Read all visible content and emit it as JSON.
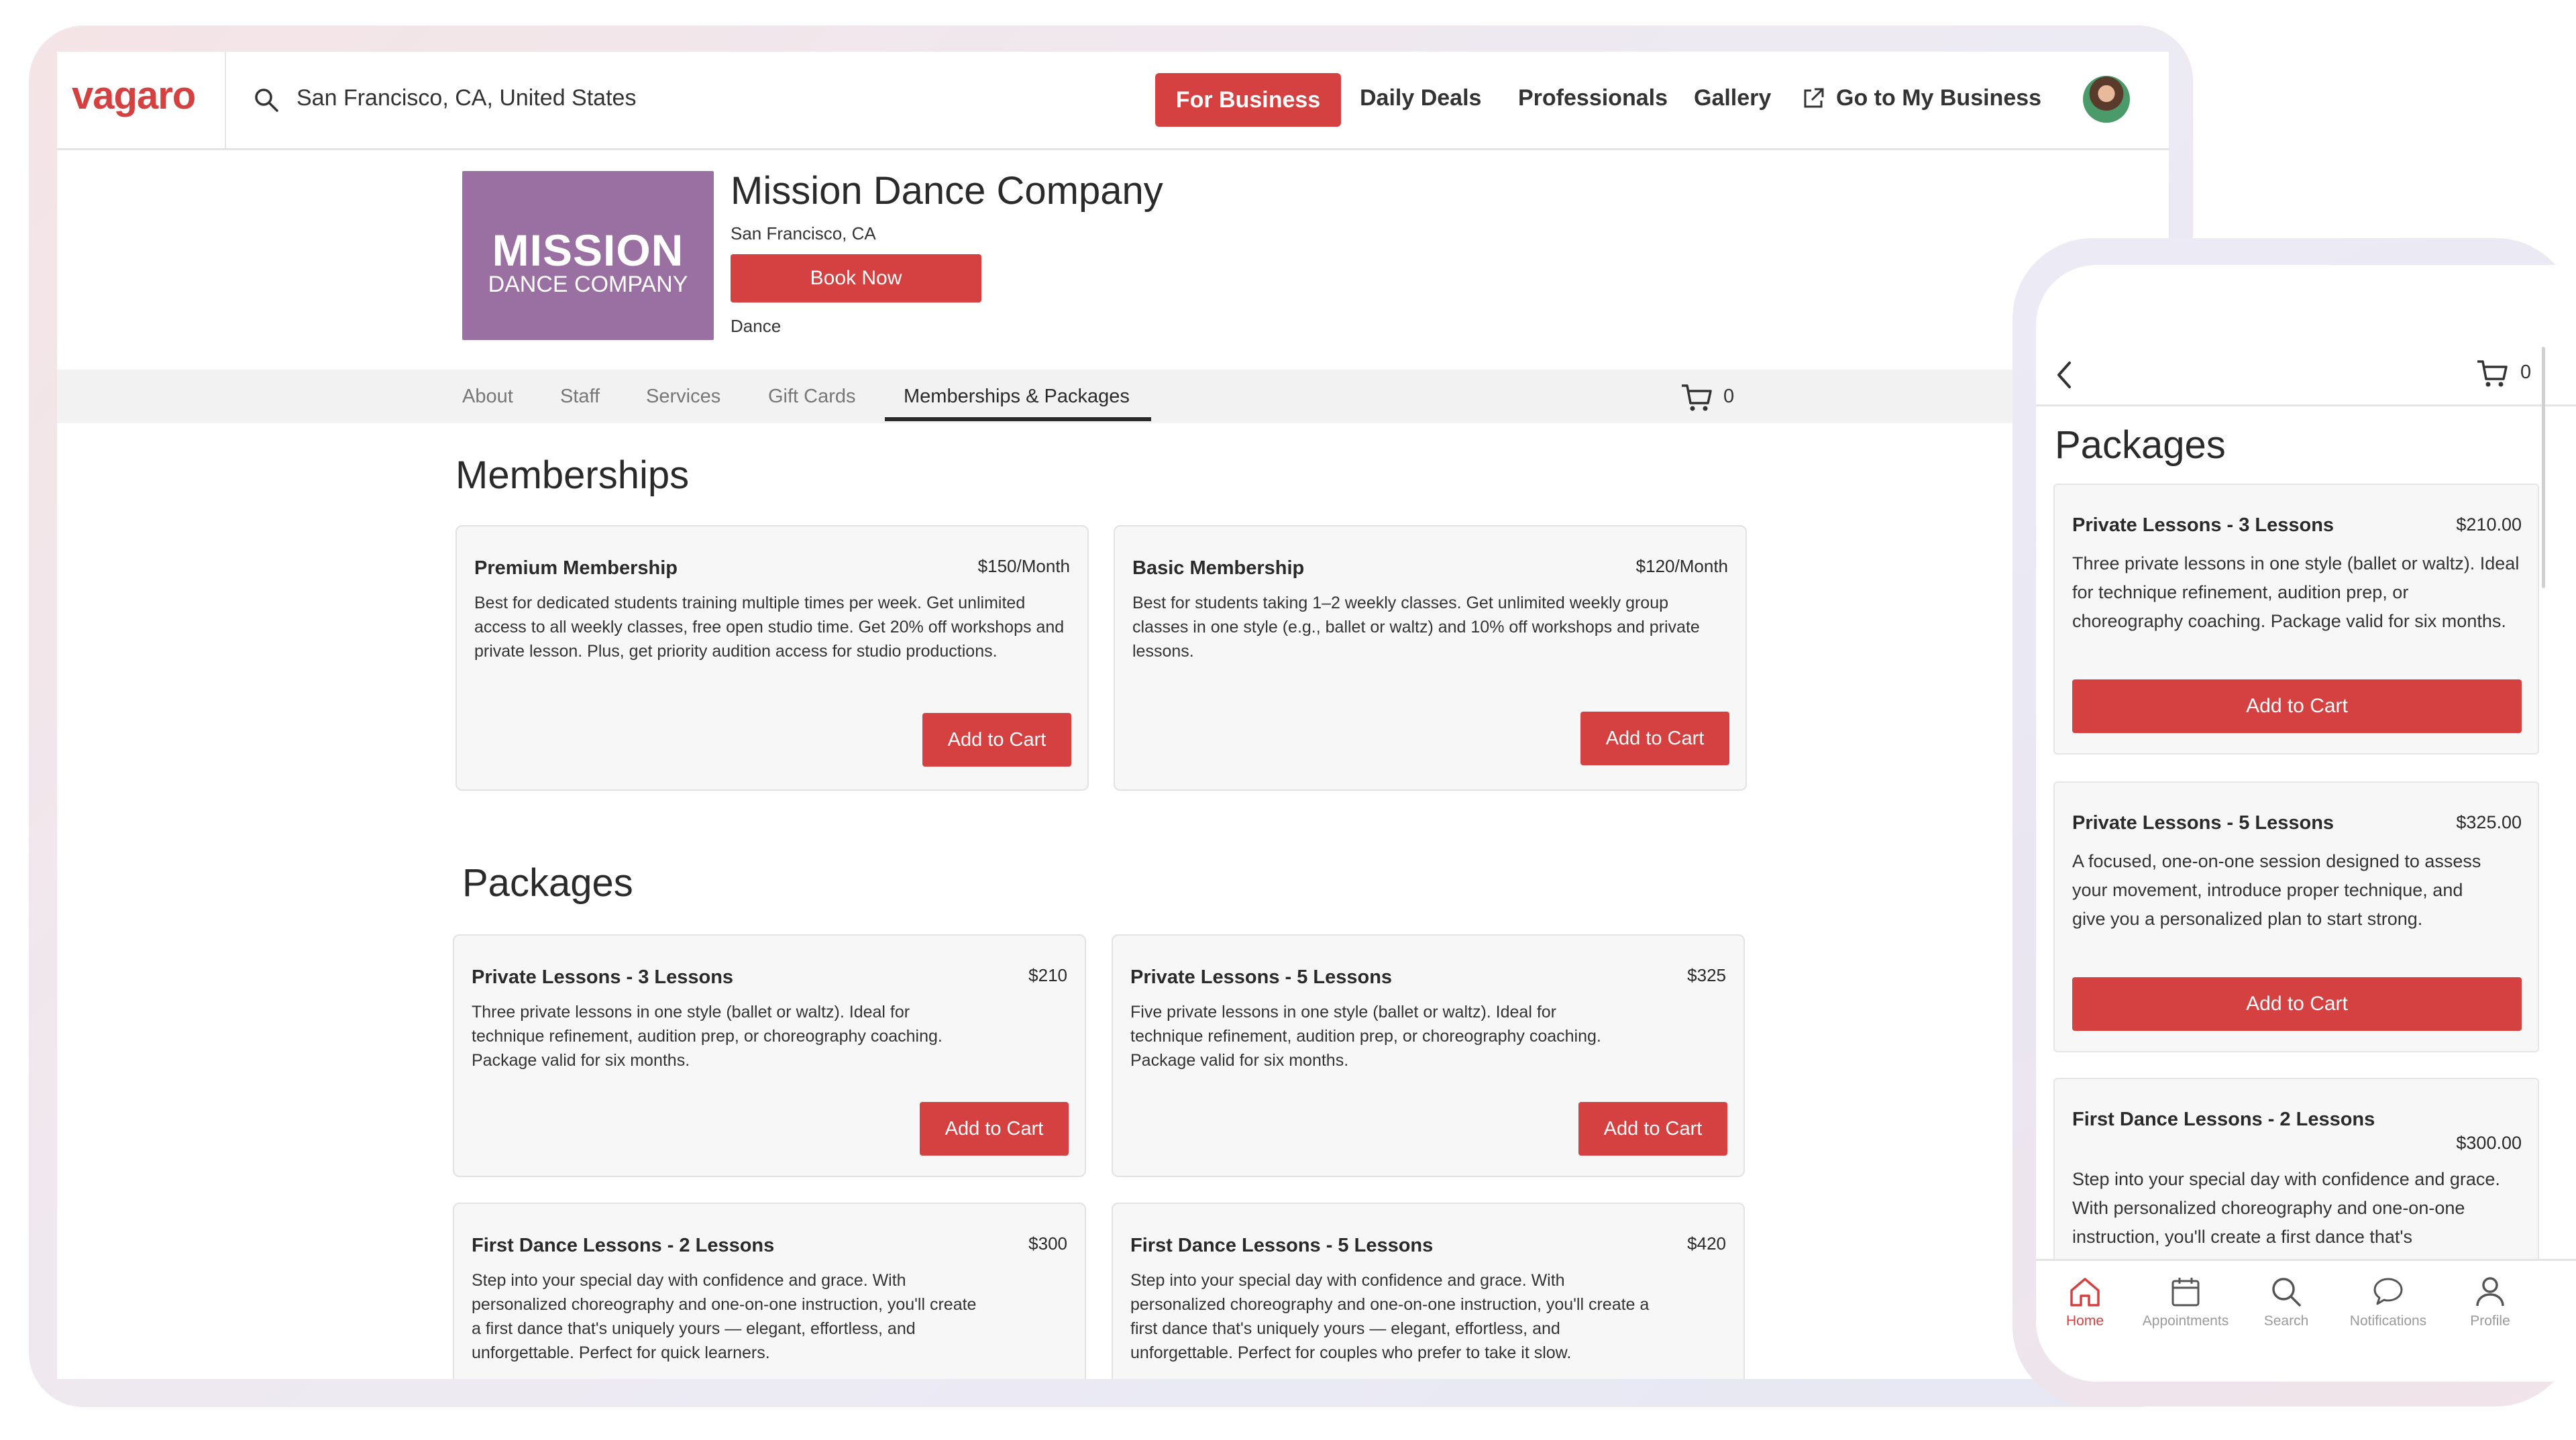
{
  "desktop": {
    "logo": "vagaro",
    "search": {
      "value": "San Francisco, CA, United States"
    },
    "nav": {
      "for_business": "For Business",
      "daily_deals": "Daily Deals",
      "professionals": "Professionals",
      "gallery": "Gallery",
      "go_to_business": "Go to My Business"
    },
    "business": {
      "logo_line1": "MISSION",
      "logo_line2": "DANCE COMPANY",
      "name": "Mission Dance Company",
      "location": "San Francisco, CA",
      "book_now": "Book Now",
      "category": "Dance"
    },
    "tabs": [
      "About",
      "Staff",
      "Services",
      "Gift Cards",
      "Memberships & Packages"
    ],
    "cart_count": "0",
    "memberships": {
      "title": "Memberships",
      "items": [
        {
          "name": "Premium Membership",
          "price": "$150/Month",
          "description": "Best for dedicated students training multiple times per week. Get unlimited access to all weekly classes, free open studio time. Get 20% off workshops and private lesson. Plus, get priority audition access for studio productions.",
          "button": "Add to Cart"
        },
        {
          "name": "Basic Membership",
          "price": "$120/Month",
          "description": "Best for students taking 1–2 weekly classes. Get unlimited weekly group classes in one style (e.g., ballet or waltz) and 10% off workshops and private lessons.",
          "button": "Add to Cart"
        }
      ]
    },
    "packages": {
      "title": "Packages",
      "items": [
        {
          "name": "Private Lessons - 3 Lessons",
          "price": "$210",
          "description": "Three private lessons in one style (ballet or waltz). Ideal for technique refinement, audition prep, or choreography coaching. Package valid for six months.",
          "button": "Add to Cart"
        },
        {
          "name": "Private Lessons - 5 Lessons",
          "price": "$325",
          "description": "Five private lessons in one style (ballet or waltz). Ideal for technique refinement, audition prep, or choreography coaching. Package valid for six months.",
          "button": "Add to Cart"
        },
        {
          "name": "First Dance Lessons - 2 Lessons",
          "price": "$300",
          "description": "Step into your special day with confidence and grace. With personalized choreography and one-on-one instruction, you'll create a first dance that's uniquely yours — elegant, effortless, and unforgettable. Perfect for quick learners."
        },
        {
          "name": "First Dance Lessons - 5 Lessons",
          "price": "$420",
          "description": "Step into your special day with confidence and grace. With personalized choreography and one-on-one instruction, you'll create a first dance that's uniquely yours — elegant, effortless, and unforgettable. Perfect for couples who prefer to take it slow."
        }
      ]
    }
  },
  "mobile": {
    "cart_count": "0",
    "title": "Packages",
    "items": [
      {
        "name": "Private Lessons - 3 Lessons",
        "price": "$210.00",
        "description": "Three private lessons in one style (ballet or waltz). Ideal for technique refinement, audition prep, or choreography coaching. Package valid for six months.",
        "button": "Add to Cart"
      },
      {
        "name": "Private Lessons - 5 Lessons",
        "price": "$325.00",
        "description": "A focused, one-on-one session designed to assess your movement, introduce proper technique, and give you a personalized plan to start strong.",
        "button": "Add to Cart"
      },
      {
        "name": "First Dance Lessons - 2 Lessons",
        "price": "$300.00",
        "description": "Step into your special day with confidence and grace. With personalized choreography and one-on-one instruction, you'll create a first dance that's"
      }
    ],
    "bottom_nav": [
      {
        "label": "Home",
        "icon": "home-icon"
      },
      {
        "label": "Appointments",
        "icon": "calendar-icon"
      },
      {
        "label": "Search",
        "icon": "search-icon"
      },
      {
        "label": "Notifications",
        "icon": "chat-bubble-icon"
      },
      {
        "label": "Profile",
        "icon": "person-icon"
      }
    ]
  },
  "colors": {
    "accent": "#d54140",
    "brand_logo_bg": "#9a6fa1",
    "tab_bar_bg": "#f2f2f2"
  }
}
